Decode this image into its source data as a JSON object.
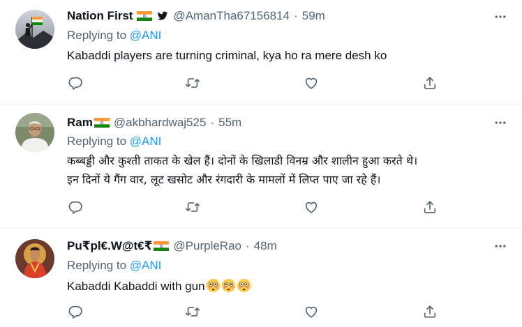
{
  "tweets": [
    {
      "name": "Nation First",
      "handle": "@AmanTha67156814",
      "time": "59m",
      "replying_prefix": "Replying to ",
      "replying_to": "@ANI",
      "text": "Kabaddi players are turning criminal, kya ho ra mere desh ko"
    },
    {
      "name": "Ram",
      "handle": "@akbhardwaj525",
      "time": "55m",
      "replying_prefix": "Replying to ",
      "replying_to": "@ANI",
      "text_line1": "कब्बड्डी और कुश्ती ताकत के खेल हैं। दोनों के खिलाडी विनम्र और शालीन हुआ करते थे।",
      "text_line2": "इन दिनों ये गैंग वार, लूट खसोट और रंगदारी के मामलों में लिप्त पाए जा रहे हैं।"
    },
    {
      "name": "Pu₹pl€.W@t€₹",
      "handle": "@PurpleRao",
      "time": "48m",
      "replying_prefix": "Replying to ",
      "replying_to": "@ANI",
      "text": "Kabaddi Kabaddi with gun"
    }
  ],
  "separator": "·",
  "icons": {
    "more": "more-horizontal-icon",
    "reply": "reply-icon",
    "retweet": "retweet-icon",
    "like": "like-icon",
    "share": "share-icon",
    "flag": "india-flag-icon",
    "verified": "twitter-bird-icon",
    "emoji": "flushed-face-emoji"
  },
  "colors": {
    "text": "#0f1419",
    "muted": "#536471",
    "link": "#1d9bf0",
    "divider": "#eff3f4"
  }
}
